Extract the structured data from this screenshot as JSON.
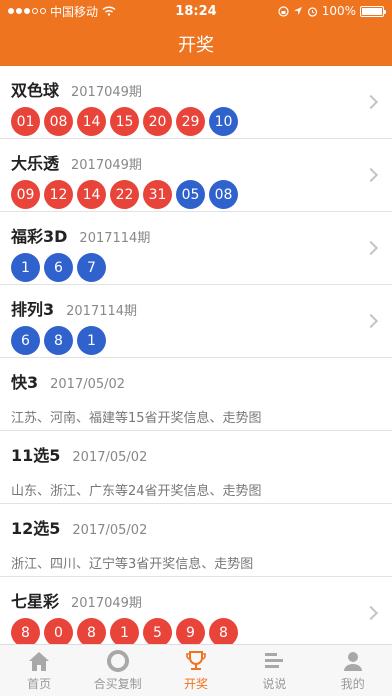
{
  "status_bar": {
    "carrier": "中国移动",
    "time": "18:24",
    "battery": "100%"
  },
  "header": {
    "title": "开奖"
  },
  "lotteries": [
    {
      "name": "双色球",
      "issue": "2017049期",
      "balls": [
        {
          "n": "01",
          "c": "red"
        },
        {
          "n": "08",
          "c": "red"
        },
        {
          "n": "14",
          "c": "red"
        },
        {
          "n": "15",
          "c": "red"
        },
        {
          "n": "20",
          "c": "red"
        },
        {
          "n": "29",
          "c": "red"
        },
        {
          "n": "10",
          "c": "blue"
        }
      ]
    },
    {
      "name": "大乐透",
      "issue": "2017049期",
      "balls": [
        {
          "n": "09",
          "c": "red"
        },
        {
          "n": "12",
          "c": "red"
        },
        {
          "n": "14",
          "c": "red"
        },
        {
          "n": "22",
          "c": "red"
        },
        {
          "n": "31",
          "c": "red"
        },
        {
          "n": "05",
          "c": "blue"
        },
        {
          "n": "08",
          "c": "blue"
        }
      ]
    },
    {
      "name": "福彩3D",
      "issue": "2017114期",
      "balls": [
        {
          "n": "1",
          "c": "blue"
        },
        {
          "n": "6",
          "c": "blue"
        },
        {
          "n": "7",
          "c": "blue"
        }
      ]
    },
    {
      "name": "排列3",
      "issue": "2017114期",
      "balls": [
        {
          "n": "6",
          "c": "blue"
        },
        {
          "n": "8",
          "c": "blue"
        },
        {
          "n": "1",
          "c": "blue"
        }
      ]
    },
    {
      "name": "快3",
      "issue": "2017/05/02",
      "desc": "江苏、河南、福建等15省开奖信息、走势图"
    },
    {
      "name": "11选5",
      "issue": "2017/05/02",
      "desc": "山东、浙江、广东等24省开奖信息、走势图"
    },
    {
      "name": "12选5",
      "issue": "2017/05/02",
      "desc": "浙江、四川、辽宁等3省开奖信息、走势图"
    },
    {
      "name": "七星彩",
      "issue": "2017049期",
      "balls": [
        {
          "n": "8",
          "c": "red"
        },
        {
          "n": "0",
          "c": "red"
        },
        {
          "n": "8",
          "c": "red"
        },
        {
          "n": "1",
          "c": "red"
        },
        {
          "n": "5",
          "c": "red"
        },
        {
          "n": "9",
          "c": "red"
        },
        {
          "n": "8",
          "c": "red"
        }
      ]
    }
  ],
  "tabs": [
    {
      "label": "首页",
      "icon": "home-icon"
    },
    {
      "label": "合买复制",
      "icon": "ring-icon"
    },
    {
      "label": "开奖",
      "icon": "trophy-icon",
      "active": true
    },
    {
      "label": "说说",
      "icon": "list-icon"
    },
    {
      "label": "我的",
      "icon": "user-icon"
    }
  ],
  "colors": {
    "accent": "#ee7420",
    "ball_red": "#e8443a",
    "ball_blue": "#2f62cc"
  }
}
